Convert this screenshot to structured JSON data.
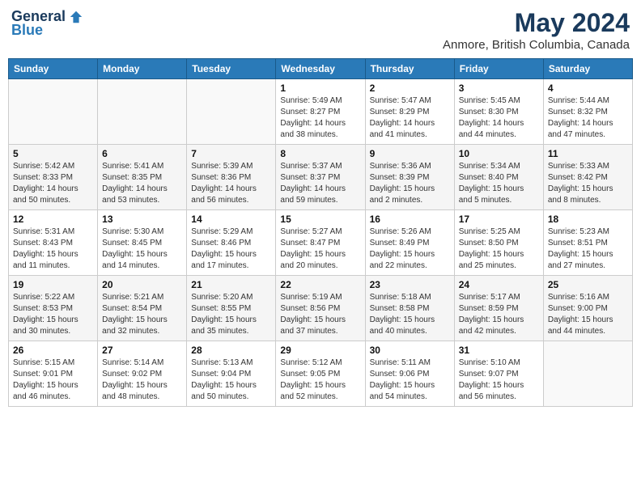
{
  "header": {
    "logo_general": "General",
    "logo_blue": "Blue",
    "month": "May 2024",
    "location": "Anmore, British Columbia, Canada"
  },
  "days_of_week": [
    "Sunday",
    "Monday",
    "Tuesday",
    "Wednesday",
    "Thursday",
    "Friday",
    "Saturday"
  ],
  "weeks": [
    [
      {
        "day": "",
        "content": ""
      },
      {
        "day": "",
        "content": ""
      },
      {
        "day": "",
        "content": ""
      },
      {
        "day": "1",
        "content": "Sunrise: 5:49 AM\nSunset: 8:27 PM\nDaylight: 14 hours\nand 38 minutes."
      },
      {
        "day": "2",
        "content": "Sunrise: 5:47 AM\nSunset: 8:29 PM\nDaylight: 14 hours\nand 41 minutes."
      },
      {
        "day": "3",
        "content": "Sunrise: 5:45 AM\nSunset: 8:30 PM\nDaylight: 14 hours\nand 44 minutes."
      },
      {
        "day": "4",
        "content": "Sunrise: 5:44 AM\nSunset: 8:32 PM\nDaylight: 14 hours\nand 47 minutes."
      }
    ],
    [
      {
        "day": "5",
        "content": "Sunrise: 5:42 AM\nSunset: 8:33 PM\nDaylight: 14 hours\nand 50 minutes."
      },
      {
        "day": "6",
        "content": "Sunrise: 5:41 AM\nSunset: 8:35 PM\nDaylight: 14 hours\nand 53 minutes."
      },
      {
        "day": "7",
        "content": "Sunrise: 5:39 AM\nSunset: 8:36 PM\nDaylight: 14 hours\nand 56 minutes."
      },
      {
        "day": "8",
        "content": "Sunrise: 5:37 AM\nSunset: 8:37 PM\nDaylight: 14 hours\nand 59 minutes."
      },
      {
        "day": "9",
        "content": "Sunrise: 5:36 AM\nSunset: 8:39 PM\nDaylight: 15 hours\nand 2 minutes."
      },
      {
        "day": "10",
        "content": "Sunrise: 5:34 AM\nSunset: 8:40 PM\nDaylight: 15 hours\nand 5 minutes."
      },
      {
        "day": "11",
        "content": "Sunrise: 5:33 AM\nSunset: 8:42 PM\nDaylight: 15 hours\nand 8 minutes."
      }
    ],
    [
      {
        "day": "12",
        "content": "Sunrise: 5:31 AM\nSunset: 8:43 PM\nDaylight: 15 hours\nand 11 minutes."
      },
      {
        "day": "13",
        "content": "Sunrise: 5:30 AM\nSunset: 8:45 PM\nDaylight: 15 hours\nand 14 minutes."
      },
      {
        "day": "14",
        "content": "Sunrise: 5:29 AM\nSunset: 8:46 PM\nDaylight: 15 hours\nand 17 minutes."
      },
      {
        "day": "15",
        "content": "Sunrise: 5:27 AM\nSunset: 8:47 PM\nDaylight: 15 hours\nand 20 minutes."
      },
      {
        "day": "16",
        "content": "Sunrise: 5:26 AM\nSunset: 8:49 PM\nDaylight: 15 hours\nand 22 minutes."
      },
      {
        "day": "17",
        "content": "Sunrise: 5:25 AM\nSunset: 8:50 PM\nDaylight: 15 hours\nand 25 minutes."
      },
      {
        "day": "18",
        "content": "Sunrise: 5:23 AM\nSunset: 8:51 PM\nDaylight: 15 hours\nand 27 minutes."
      }
    ],
    [
      {
        "day": "19",
        "content": "Sunrise: 5:22 AM\nSunset: 8:53 PM\nDaylight: 15 hours\nand 30 minutes."
      },
      {
        "day": "20",
        "content": "Sunrise: 5:21 AM\nSunset: 8:54 PM\nDaylight: 15 hours\nand 32 minutes."
      },
      {
        "day": "21",
        "content": "Sunrise: 5:20 AM\nSunset: 8:55 PM\nDaylight: 15 hours\nand 35 minutes."
      },
      {
        "day": "22",
        "content": "Sunrise: 5:19 AM\nSunset: 8:56 PM\nDaylight: 15 hours\nand 37 minutes."
      },
      {
        "day": "23",
        "content": "Sunrise: 5:18 AM\nSunset: 8:58 PM\nDaylight: 15 hours\nand 40 minutes."
      },
      {
        "day": "24",
        "content": "Sunrise: 5:17 AM\nSunset: 8:59 PM\nDaylight: 15 hours\nand 42 minutes."
      },
      {
        "day": "25",
        "content": "Sunrise: 5:16 AM\nSunset: 9:00 PM\nDaylight: 15 hours\nand 44 minutes."
      }
    ],
    [
      {
        "day": "26",
        "content": "Sunrise: 5:15 AM\nSunset: 9:01 PM\nDaylight: 15 hours\nand 46 minutes."
      },
      {
        "day": "27",
        "content": "Sunrise: 5:14 AM\nSunset: 9:02 PM\nDaylight: 15 hours\nand 48 minutes."
      },
      {
        "day": "28",
        "content": "Sunrise: 5:13 AM\nSunset: 9:04 PM\nDaylight: 15 hours\nand 50 minutes."
      },
      {
        "day": "29",
        "content": "Sunrise: 5:12 AM\nSunset: 9:05 PM\nDaylight: 15 hours\nand 52 minutes."
      },
      {
        "day": "30",
        "content": "Sunrise: 5:11 AM\nSunset: 9:06 PM\nDaylight: 15 hours\nand 54 minutes."
      },
      {
        "day": "31",
        "content": "Sunrise: 5:10 AM\nSunset: 9:07 PM\nDaylight: 15 hours\nand 56 minutes."
      },
      {
        "day": "",
        "content": ""
      }
    ]
  ]
}
